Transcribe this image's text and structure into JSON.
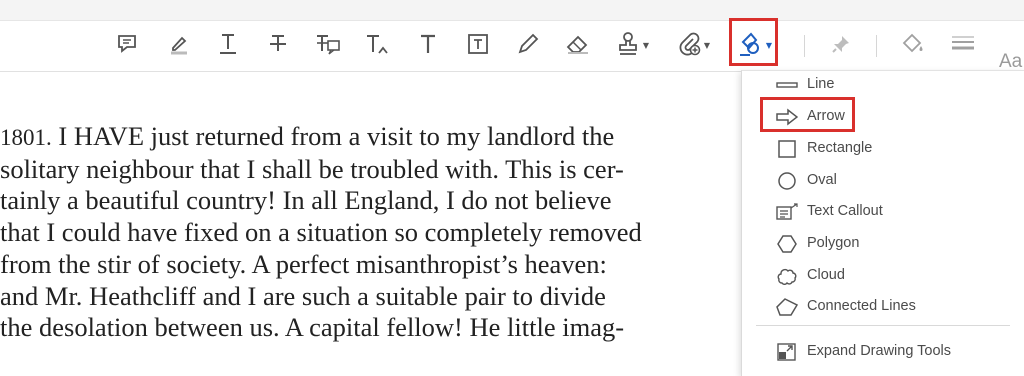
{
  "toolbar": {
    "tools": [
      {
        "name": "add-comment",
        "icon": "comment-icon"
      },
      {
        "name": "highlight",
        "icon": "highlighter-icon"
      },
      {
        "name": "underline",
        "icon": "underline-text-icon"
      },
      {
        "name": "strikethrough",
        "icon": "strikethrough-text-icon"
      },
      {
        "name": "replace-text",
        "icon": "replace-text-icon"
      },
      {
        "name": "insert-text",
        "icon": "insert-text-icon"
      },
      {
        "name": "add-text",
        "icon": "text-icon"
      },
      {
        "name": "text-box",
        "icon": "text-box-icon"
      },
      {
        "name": "draw",
        "icon": "pencil-icon"
      },
      {
        "name": "erase",
        "icon": "eraser-icon"
      },
      {
        "name": "stamp",
        "icon": "stamp-icon"
      },
      {
        "name": "attach",
        "icon": "paperclip-icon"
      },
      {
        "name": "drawing-tools",
        "icon": "shapes-icon"
      },
      {
        "name": "pin",
        "icon": "pin-icon"
      },
      {
        "name": "fill",
        "icon": "paint-bucket-icon"
      },
      {
        "name": "line-weight",
        "icon": "line-weight-icon"
      }
    ],
    "font_size_label": "Aa",
    "highlight_color": "#d9302c"
  },
  "document": {
    "lines": [
      {
        "num": "1801.",
        "text": " I HAVE just returned from a visit to my landlord the"
      },
      {
        "text": "solitary neighbour that I shall be troubled with. This is cer-"
      },
      {
        "text": "tainly a beautiful country! In all England, I do not believe"
      },
      {
        "text": "that I could have fixed on a situation so completely removed"
      },
      {
        "text": "from the stir of society. A perfect misanthropist’s heaven:"
      },
      {
        "text": "and Mr. Heathcliff and I are such a suitable pair to divide"
      },
      {
        "text": "the desolation between us. A capital fellow! He little imag-"
      }
    ]
  },
  "menu": {
    "items": [
      {
        "label": "Line",
        "icon": "line-icon"
      },
      {
        "label": "Arrow",
        "icon": "arrow-icon"
      },
      {
        "label": "Rectangle",
        "icon": "rectangle-icon"
      },
      {
        "label": "Oval",
        "icon": "oval-icon"
      },
      {
        "label": "Text Callout",
        "icon": "text-callout-icon"
      },
      {
        "label": "Polygon",
        "icon": "polygon-icon"
      },
      {
        "label": "Cloud",
        "icon": "cloud-icon"
      },
      {
        "label": "Connected Lines",
        "icon": "connected-lines-icon"
      }
    ],
    "expand_label": "Expand Drawing Tools",
    "expand_icon": "expand-icon",
    "selected": "Arrow"
  }
}
